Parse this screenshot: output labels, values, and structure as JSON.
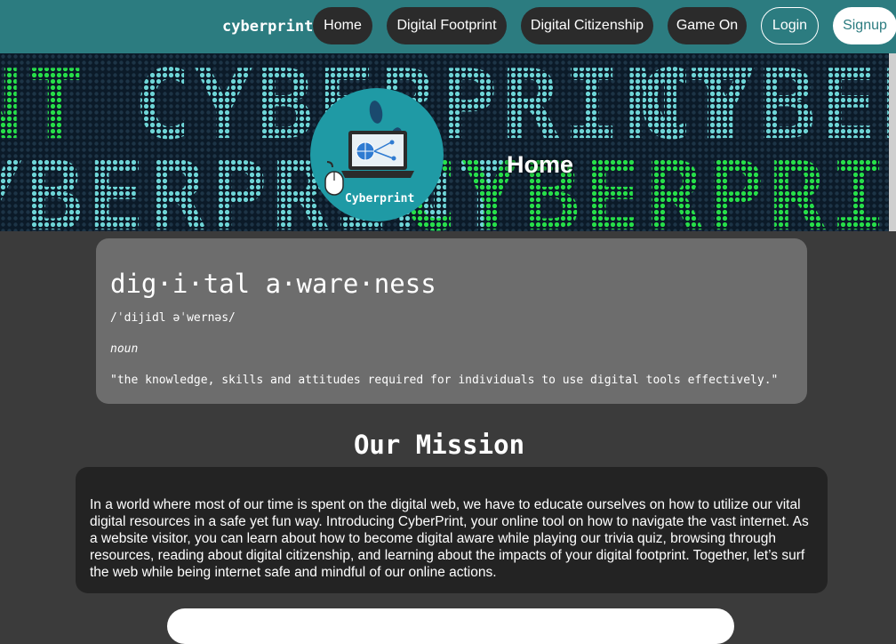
{
  "navbar": {
    "brand": "cyberprint",
    "items": [
      {
        "label": "Home"
      },
      {
        "label": "Digital Footprint"
      },
      {
        "label": "Digital Citizenship"
      },
      {
        "label": "Game On"
      },
      {
        "label": "Login"
      },
      {
        "label": "Signup"
      }
    ]
  },
  "hero": {
    "title": "Home",
    "banner_text": "CYBERPRINT",
    "logo_text": "Cyberprint"
  },
  "definition": {
    "word": "dig·i·tal a·ware·ness",
    "pronunciation": "/ˈdijidl əˈwernəs/",
    "part_of_speech": "noun",
    "meaning": "\"the knowledge, skills and attitudes required for individuals to use digital tools effectively.\""
  },
  "mission": {
    "title": "Our Mission",
    "body": "In a world where most of our time is spent on the digital web, we have to educate ourselves on how to utilize our vital digital resources in a safe yet fun way. Introducing CyberPrint, your online tool on how to navigate the vast internet. As a website visitor, you can learn about how to become digital aware while playing our trivia quiz, browsing through resources, reading about digital citizenship, and learning about the impacts of your digital footprint. Together, let’s surf the web while being internet safe and mindful of our online actions."
  },
  "colors": {
    "nav": "#2c7c80",
    "page_bg": "#3b3b3b",
    "card_light": "#6d6d6d",
    "card_dark": "#232323",
    "led_green": "#27e04a",
    "led_cyan": "#6fd6d8"
  }
}
